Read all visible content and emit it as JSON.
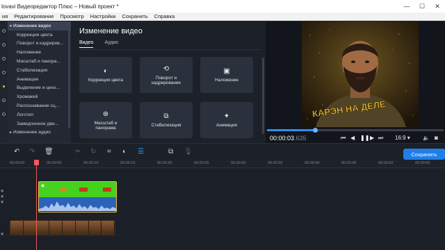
{
  "titlebar": {
    "title": "lovavi Видеоредактор Плюс – Новый проект *",
    "minimize": "—",
    "maximize": "☐",
    "close": "✕"
  },
  "menu": {
    "items": [
      "ия",
      "Редактирование",
      "Просмотр",
      "Настройки",
      "Сохранить",
      "Справка"
    ]
  },
  "sidebar": {
    "items": [
      {
        "label": "Изменение видео",
        "state": "active"
      },
      {
        "label": "Коррекция цвета",
        "state": "normal"
      },
      {
        "label": "Поворот и кадриров...",
        "state": "normal"
      },
      {
        "label": "Наложение",
        "state": "normal"
      },
      {
        "label": "Масштаб и панора...",
        "state": "normal"
      },
      {
        "label": "Стабилизация",
        "state": "normal"
      },
      {
        "label": "Анимация",
        "state": "normal"
      },
      {
        "label": "Выделение и ценз...",
        "state": "normal"
      },
      {
        "label": "Хромакей",
        "state": "normal"
      },
      {
        "label": "Распознавание сц...",
        "state": "normal"
      },
      {
        "label": "Логотип",
        "state": "normal"
      },
      {
        "label": "Замедленное дви...",
        "state": "normal"
      },
      {
        "label": "Изменение аудио",
        "state": "group"
      }
    ]
  },
  "panel": {
    "heading": "Изменение видео",
    "tabs": [
      {
        "label": "Видео",
        "active": true
      },
      {
        "label": "Аудио",
        "active": false
      }
    ],
    "tiles": [
      {
        "label": "Коррекция цвета",
        "icon": "color-correction-icon",
        "glyph": "◐"
      },
      {
        "label": "Поворот и кадрирование",
        "icon": "crop-rotate-icon",
        "glyph": "⟲"
      },
      {
        "label": "Наложение",
        "icon": "overlay-icon",
        "glyph": "▣"
      },
      {
        "label": "Масштаб и панорама",
        "icon": "zoom-pan-icon",
        "glyph": "⊕"
      },
      {
        "label": "Стабилизация",
        "icon": "stabilization-icon",
        "glyph": "⧉"
      },
      {
        "label": "Анимация",
        "icon": "animation-icon",
        "glyph": "✦"
      }
    ]
  },
  "preview": {
    "overlay_text": "КАРЭН НА ДЕЛЕ",
    "progress": 0.27,
    "timecode_main": "00:00:03",
    "timecode_frac": ".635",
    "aspect_ratio": "16:9 ▾"
  },
  "toolbar": {
    "save_label": "Сохранить"
  },
  "timeline": {
    "ruler_labels": [
      "00:00:00",
      "00:00:05",
      "00:00:10",
      "00:00:15",
      "00:00:20",
      "00:00:25",
      "00:00:30",
      "00:00:35",
      "00:00:40",
      "00:00:45",
      "00:00:50",
      "00:00:55"
    ]
  },
  "colors": {
    "accent": "#1f7ee8",
    "clip_green": "#45d11d",
    "clip_border": "#f0c24a",
    "playhead": "#f05a5a"
  }
}
